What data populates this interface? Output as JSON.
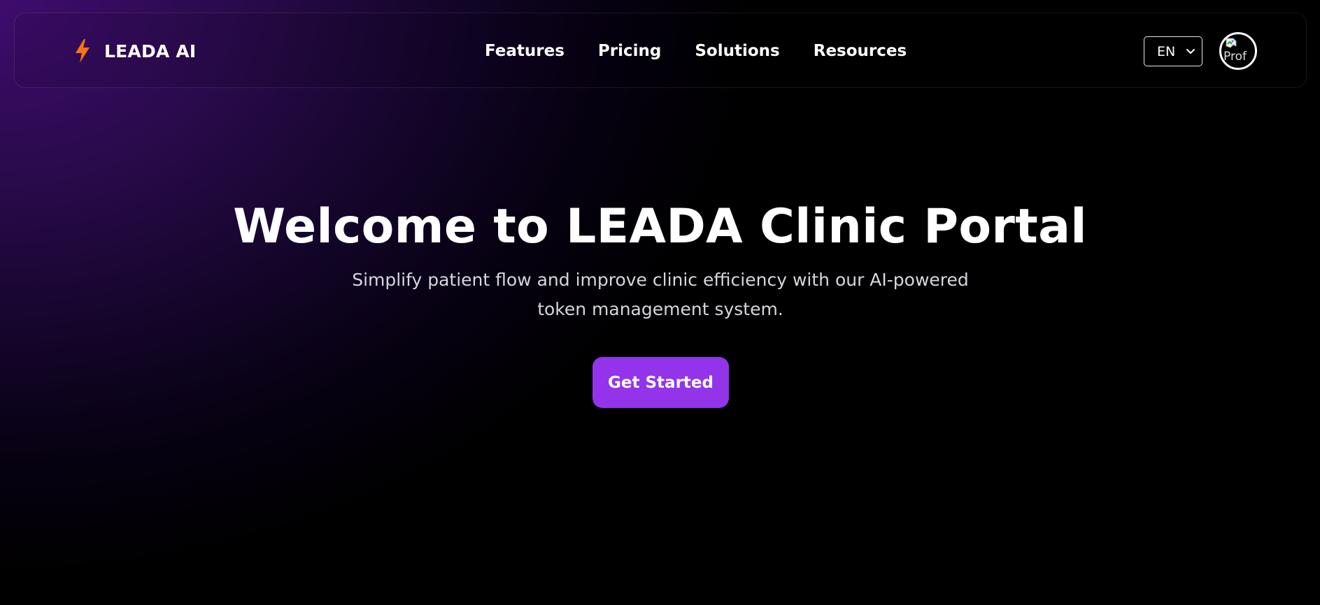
{
  "brand": {
    "name": "LEADA AI",
    "icon": "lightning-bolt-icon",
    "icon_color": "#f97316"
  },
  "nav": {
    "links": [
      {
        "label": "Features"
      },
      {
        "label": "Pricing"
      },
      {
        "label": "Solutions"
      },
      {
        "label": "Resources"
      }
    ]
  },
  "language": {
    "selected": "EN",
    "icon": "chevron-down-icon"
  },
  "profile": {
    "avatar_alt": "Prof",
    "icon": "broken-image-icon"
  },
  "hero": {
    "title": "Welcome to LEADA Clinic Portal",
    "subtitle": "Simplify patient flow and improve clinic efficiency with our AI-powered token management system.",
    "cta_label": "Get Started"
  },
  "colors": {
    "accent": "#9333ea",
    "background_top_left": "#3f0c6e",
    "background": "#000000",
    "text": "#ffffff"
  }
}
